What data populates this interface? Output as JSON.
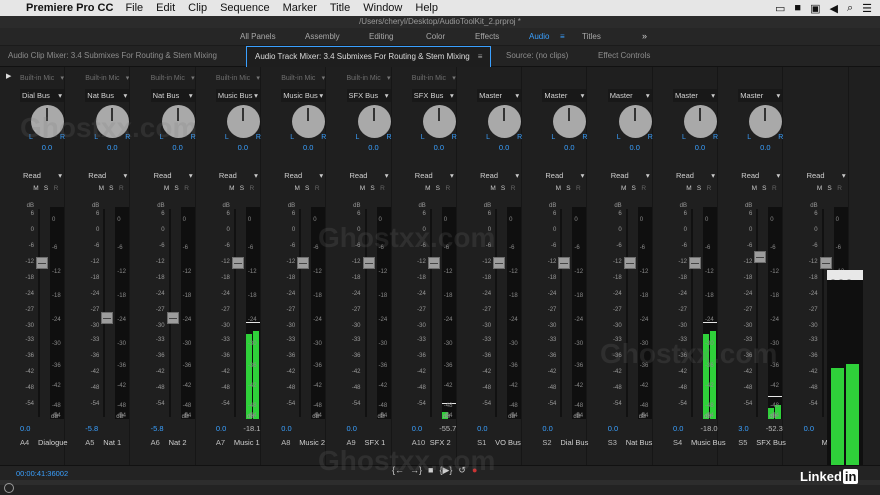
{
  "menubar": {
    "app_name": "Premiere Pro CC",
    "items": [
      "File",
      "Edit",
      "Clip",
      "Sequence",
      "Marker",
      "Title",
      "Window",
      "Help"
    ]
  },
  "window": {
    "path": "/Users/cheryl/Desktop/AudioToolKit_2.prproj *"
  },
  "workspaces": {
    "items": [
      "All Panels",
      "Assembly",
      "Editing",
      "Color",
      "Effects",
      "Audio",
      "Titles"
    ],
    "active": "Audio",
    "more": "»"
  },
  "panel_tabs": {
    "clip_mixer": "Audio Clip Mixer: 3.4 Submixes For Routing & Stem Mixing",
    "track_mixer": "Audio Track Mixer: 3.4 Submixes For Routing & Stem Mixing",
    "track_mixer_menu": "≡",
    "source": "Source: (no clips)",
    "effect_controls": "Effect Controls"
  },
  "db_scale": [
    "dB",
    "6",
    "0",
    "-6",
    "-12",
    "-18",
    "-24",
    "-27",
    "-30",
    "-33",
    "-36",
    "-42",
    "-48",
    "-54"
  ],
  "meter_scale": [
    "0",
    "-6",
    "-12",
    "-18",
    "-24",
    "-30",
    "-36",
    "-42",
    "-48",
    "-54"
  ],
  "meter_bottom_label": "dB",
  "tracks": [
    {
      "id": "A4",
      "name": "Dialogue",
      "insert": "Built-in Mic",
      "route": "Dial Bus",
      "pan": "0.0",
      "automation": "Read",
      "volume": "0.0",
      "peak": "",
      "meter_l": 0,
      "meter_r": 0
    },
    {
      "id": "A5",
      "name": "Nat 1",
      "insert": "Built-in Mic",
      "route": "Nat Bus",
      "pan": "0.0",
      "automation": "Read",
      "volume": "-5.8",
      "peak": "",
      "meter_l": 0,
      "meter_r": 0
    },
    {
      "id": "A6",
      "name": "Nat 2",
      "insert": "Built-in Mic",
      "route": "Nat Bus",
      "pan": "0.0",
      "automation": "Read",
      "volume": "-5.8",
      "peak": "",
      "meter_l": 0,
      "meter_r": 0
    },
    {
      "id": "A7",
      "name": "Music 1",
      "insert": "Built-in Mic",
      "route": "Music Bus",
      "pan": "0.0",
      "automation": "Read",
      "volume": "0.0",
      "peak": "-18.1",
      "meter_l": 0.62,
      "meter_r": 0.64
    },
    {
      "id": "A8",
      "name": "Music 2",
      "insert": "Built-in Mic",
      "route": "Music Bus",
      "pan": "0.0",
      "automation": "Read",
      "volume": "0.0",
      "peak": "",
      "meter_l": 0,
      "meter_r": 0
    },
    {
      "id": "A9",
      "name": "SFX 1",
      "insert": "Built-in Mic",
      "route": "SFX Bus",
      "pan": "0.0",
      "automation": "Read",
      "volume": "0.0",
      "peak": "",
      "meter_l": 0,
      "meter_r": 0
    },
    {
      "id": "A10",
      "name": "SFX 2",
      "insert": "Built-in Mic",
      "route": "SFX Bus",
      "pan": "0.0",
      "automation": "Read",
      "volume": "0.0",
      "peak": "-55.7",
      "meter_l": 0.05,
      "meter_r": 0
    },
    {
      "id": "S1",
      "name": "VO Bus",
      "insert": "",
      "route": "Master",
      "pan": "0.0",
      "automation": "Read",
      "volume": "0.0",
      "peak": "",
      "meter_l": 0,
      "meter_r": 0
    },
    {
      "id": "S2",
      "name": "Dial Bus",
      "insert": "",
      "route": "Master",
      "pan": "0.0",
      "automation": "Read",
      "volume": "0.0",
      "peak": "",
      "meter_l": 0,
      "meter_r": 0
    },
    {
      "id": "S3",
      "name": "Nat Bus",
      "insert": "",
      "route": "Master",
      "pan": "0.0",
      "automation": "Read",
      "volume": "0.0",
      "peak": "",
      "meter_l": 0,
      "meter_r": 0
    },
    {
      "id": "S4",
      "name": "Music Bus",
      "insert": "",
      "route": "Master",
      "pan": "0.0",
      "automation": "Read",
      "volume": "0.0",
      "peak": "-18.0",
      "meter_l": 0.62,
      "meter_r": 0.64
    },
    {
      "id": "S5",
      "name": "SFX Bus",
      "insert": "",
      "route": "Master",
      "pan": "0.0",
      "automation": "Read",
      "volume": "3.0",
      "peak": "-52.3",
      "meter_l": 0.08,
      "meter_r": 0.1
    },
    {
      "id": "",
      "name": "M",
      "insert": "",
      "route": "",
      "pan": "",
      "automation": "Read",
      "volume": "0.0",
      "peak": "",
      "meter_l": 0,
      "meter_r": 0
    }
  ],
  "master_meter": {
    "l": 0.55,
    "r": 0.57
  },
  "transport": {
    "timecode": "00:00:41:36002",
    "buttons": [
      "{←",
      "→}",
      "■",
      "{▶}",
      "↺",
      "●"
    ]
  },
  "branding": {
    "linked": "Linked",
    "in": "in"
  },
  "watermark": "Ghostxx.com",
  "colors": {
    "accent": "#3aa0ff",
    "meter": "#2fd13a",
    "record": "#c33333"
  }
}
